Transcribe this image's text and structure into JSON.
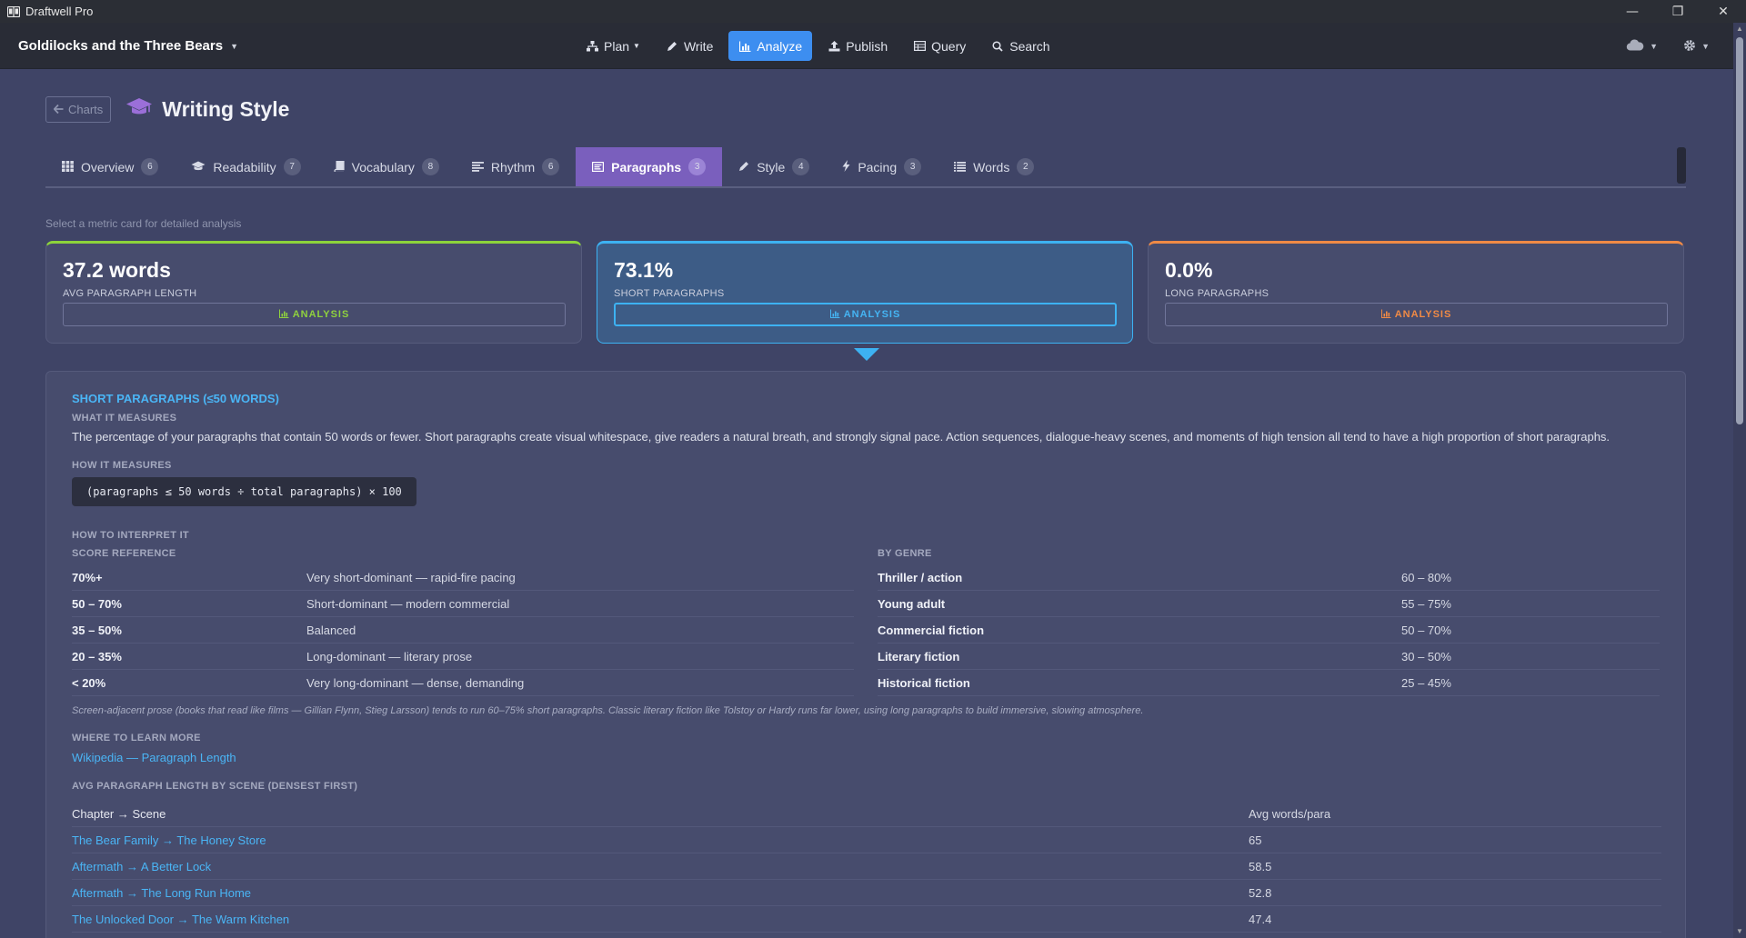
{
  "window": {
    "app_title": "Draftwell Pro",
    "controls": {
      "minimize": "—",
      "maximize": "❐",
      "close": "✕"
    }
  },
  "navbar": {
    "project_title": "Goldilocks and the Three Bears",
    "items": [
      {
        "label": "Plan",
        "icon": "sitemap-icon",
        "dropdown": true
      },
      {
        "label": "Write",
        "icon": "pencil-icon"
      },
      {
        "label": "Analyze",
        "icon": "bar-chart-icon",
        "active": true
      },
      {
        "label": "Publish",
        "icon": "upload-icon"
      },
      {
        "label": "Query",
        "icon": "table-icon"
      },
      {
        "label": "Search",
        "icon": "search-icon"
      }
    ],
    "right": {
      "cloud_icon": "cloud-icon",
      "settings_icon": "gear-icon"
    },
    "accent_color": "#3d8ef0"
  },
  "page": {
    "back_label": "Charts",
    "title": "Writing Style",
    "title_icon_color": "#9b6fd9"
  },
  "tabs": [
    {
      "label": "Overview",
      "count": "6",
      "icon": "grid-icon"
    },
    {
      "label": "Readability",
      "count": "7",
      "icon": "graduation-cap-icon"
    },
    {
      "label": "Vocabulary",
      "count": "8",
      "icon": "book-icon"
    },
    {
      "label": "Rhythm",
      "count": "6",
      "icon": "align-left-icon"
    },
    {
      "label": "Paragraphs",
      "count": "3",
      "icon": "paragraph-icon",
      "active": true
    },
    {
      "label": "Style",
      "count": "4",
      "icon": "pen-icon"
    },
    {
      "label": "Pacing",
      "count": "3",
      "icon": "bolt-icon"
    },
    {
      "label": "Words",
      "count": "2",
      "icon": "list-icon"
    }
  ],
  "hint": "Select a metric card for detailed analysis",
  "cards": [
    {
      "value": "37.2 words",
      "label": "AVG PARAGRAPH LENGTH",
      "button": "ANALYSIS",
      "color": "#8dd43b"
    },
    {
      "value": "73.1%",
      "label": "SHORT PARAGRAPHS",
      "button": "ANALYSIS",
      "color": "#3db2f2",
      "selected": true
    },
    {
      "value": "0.0%",
      "label": "LONG PARAGRAPHS",
      "button": "ANALYSIS",
      "color": "#f08a45"
    }
  ],
  "detail": {
    "title": "SHORT PARAGRAPHS (≤50 WORDS)",
    "what_heading": "WHAT IT MEASURES",
    "what_text": "The percentage of your paragraphs that contain 50 words or fewer. Short paragraphs create visual whitespace, give readers a natural breath, and strongly signal pace. Action sequences, dialogue-heavy scenes, and moments of high tension all tend to have a high proportion of short paragraphs.",
    "how_heading": "HOW IT MEASURES",
    "formula": "(paragraphs ≤ 50 words ÷ total paragraphs) × 100",
    "interpret_heading": "HOW TO INTERPRET IT",
    "score_heading": "SCORE REFERENCE",
    "genre_heading": "BY GENRE",
    "score_reference": [
      {
        "range": "70%+",
        "meaning": "Very short-dominant — rapid-fire pacing"
      },
      {
        "range": "50 – 70%",
        "meaning": "Short-dominant — modern commercial"
      },
      {
        "range": "35 – 50%",
        "meaning": "Balanced"
      },
      {
        "range": "20 – 35%",
        "meaning": "Long-dominant — literary prose"
      },
      {
        "range": "< 20%",
        "meaning": "Very long-dominant — dense, demanding"
      }
    ],
    "by_genre": [
      {
        "genre": "Thriller / action",
        "range": "60 – 80%"
      },
      {
        "genre": "Young adult",
        "range": "55 – 75%"
      },
      {
        "genre": "Commercial fiction",
        "range": "50 – 70%"
      },
      {
        "genre": "Literary fiction",
        "range": "30 – 50%"
      },
      {
        "genre": "Historical fiction",
        "range": "25 – 45%"
      }
    ],
    "note": "Screen-adjacent prose (books that read like films — Gillian Flynn, Stieg Larsson) tends to run 60–75% short paragraphs. Classic literary fiction like Tolstoy or Hardy runs far lower, using long paragraphs to build immersive, slowing atmosphere.",
    "learn_heading": "WHERE TO LEARN MORE",
    "learn_link": "Wikipedia — Paragraph Length",
    "scene_heading": "AVG PARAGRAPH LENGTH BY SCENE (DENSEST FIRST)",
    "scene_columns": [
      "Chapter → Scene",
      "Avg words/para"
    ],
    "scenes": [
      {
        "scene": "The Bear Family → The Honey Store",
        "avg": "65"
      },
      {
        "scene": "Aftermath → A Better Lock",
        "avg": "58.5"
      },
      {
        "scene": "Aftermath → The Long Run Home",
        "avg": "52.8"
      },
      {
        "scene": "The Unlocked Door → The Warm Kitchen",
        "avg": "47.4"
      }
    ]
  }
}
